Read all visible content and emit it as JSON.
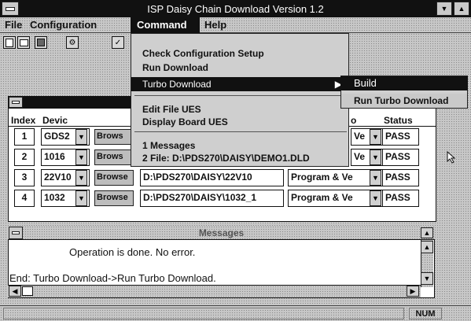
{
  "window": {
    "title": "ISP Daisy Chain Download Version 1.2"
  },
  "menubar": {
    "items": [
      {
        "label": "File"
      },
      {
        "label": "Configuration"
      },
      {
        "label": "Command"
      },
      {
        "label": "Help"
      }
    ]
  },
  "command_menu": {
    "items": [
      "Check Configuration Setup",
      "Run Download",
      "Turbo Download",
      "Edit File UES",
      "Display Board UES",
      "1 Messages",
      "2 File: D:\\PDS270\\DAISY\\DEMO1.DLD"
    ]
  },
  "turbo_submenu": {
    "items": [
      "Build",
      "Run Turbo Download"
    ]
  },
  "grid": {
    "headers": {
      "index": "Index",
      "device": "Devic",
      "op": "o",
      "status": "Status"
    },
    "rows": [
      {
        "index": "1",
        "device": "GDS2",
        "browse": "Brows",
        "file": "",
        "op": "Ve",
        "status": "PASS"
      },
      {
        "index": "2",
        "device": "1016",
        "browse": "Brows",
        "file": "",
        "op": "Ve",
        "status": "PASS"
      },
      {
        "index": "3",
        "device": "22V10",
        "browse": "Browse",
        "file": "D:\\PDS270\\DAISY\\22V10",
        "op": "Program & Ve",
        "status": "PASS"
      },
      {
        "index": "4",
        "device": "1032",
        "browse": "Browse",
        "file": "D:\\PDS270\\DAISY\\1032_1",
        "op": "Program & Ve",
        "status": "PASS"
      }
    ]
  },
  "messages": {
    "title": "Messages",
    "line1": "Operation is done. No error.",
    "line2": "End: Turbo Download->Run Turbo Download."
  },
  "statusbar": {
    "num": "NUM"
  }
}
